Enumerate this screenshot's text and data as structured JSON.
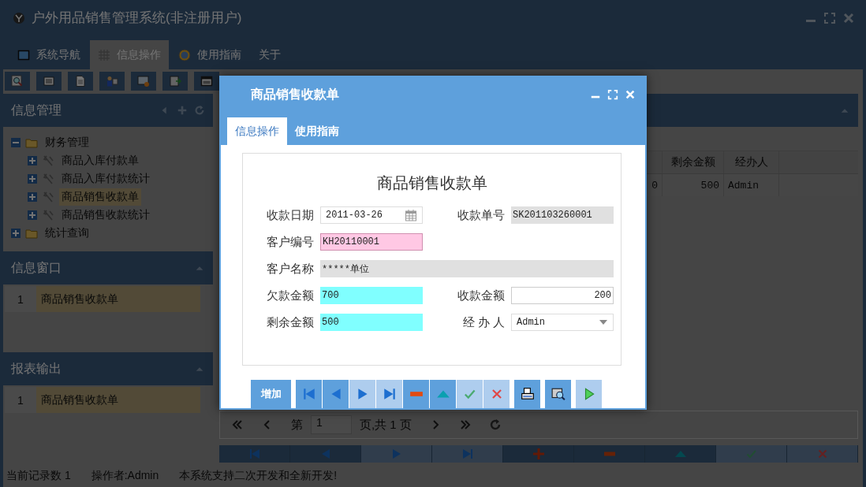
{
  "window": {
    "title": "户外用品销售管理系统(非注册用户)"
  },
  "tabs": [
    {
      "label": "系统导航",
      "selected": false
    },
    {
      "label": "信息操作",
      "selected": true
    },
    {
      "label": "使用指南",
      "selected": false
    },
    {
      "label": "关于",
      "selected": false
    }
  ],
  "toolbar": [
    {
      "kind": "search"
    },
    {
      "kind": "list"
    },
    {
      "kind": "document"
    },
    {
      "kind": "users"
    },
    {
      "kind": "monitor"
    },
    {
      "kind": "export"
    },
    {
      "kind": "window"
    }
  ],
  "sidebar": {
    "tree_title": "信息管理",
    "tree": [
      {
        "label": "财务管理",
        "kind": "folder",
        "expanded": true,
        "selected": false,
        "children": [
          {
            "label": "商品入库付款单",
            "kind": "tool",
            "expanded": false,
            "selected": false
          },
          {
            "label": "商品入库付款统计",
            "kind": "tool",
            "expanded": false,
            "selected": false
          },
          {
            "label": "商品销售收款单",
            "kind": "tool",
            "expanded": false,
            "selected": true
          },
          {
            "label": "商品销售收款统计",
            "kind": "tool",
            "expanded": false,
            "selected": false
          }
        ]
      },
      {
        "label": "统计查询",
        "kind": "folder",
        "expanded": false,
        "selected": false
      }
    ],
    "lists": [
      {
        "title": "信息窗口",
        "rows": [
          {
            "index": "1",
            "label": "商品销售收款单"
          }
        ]
      },
      {
        "title": "报表输出",
        "rows": [
          {
            "index": "1",
            "label": "商品销售收款单"
          }
        ]
      }
    ]
  },
  "grid": {
    "columns": [
      "",
      "剩余金额",
      "经办人"
    ],
    "rows": [
      {
        "cells": [
          "0",
          "500",
          "Admin"
        ]
      }
    ]
  },
  "pager": {
    "page_word": "第",
    "page": "1",
    "total": "页,共 1 页"
  },
  "record_bar": [
    {
      "kind": "first",
      "disabled": false
    },
    {
      "kind": "prev",
      "disabled": false
    },
    {
      "kind": "next",
      "disabled": true
    },
    {
      "kind": "last",
      "disabled": true
    },
    {
      "kind": "add",
      "disabled": false
    },
    {
      "kind": "remove",
      "disabled": false
    },
    {
      "kind": "up",
      "disabled": false
    },
    {
      "kind": "confirm",
      "disabled": true
    },
    {
      "kind": "cancel",
      "disabled": true
    }
  ],
  "status_bar": [
    "当前记录数 1",
    "操作者:Admin",
    "本系统支持二次开发和全新开发!"
  ],
  "dialog": {
    "title": "商品销售收款单",
    "tabs": [
      {
        "label": "信息操作",
        "selected": true
      },
      {
        "label": "使用指南",
        "selected": false
      }
    ],
    "form_title": "商品销售收款单",
    "rows": [
      {
        "fields": [
          {
            "label": "收款日期",
            "value": "2011-03-26",
            "kind": "date"
          },
          {
            "label": "收款单号",
            "value": "SK201103260001",
            "kind": "readonly"
          }
        ]
      },
      {
        "fields": [
          {
            "label": "客户编号",
            "value": "KH20110001",
            "kind": "lookup"
          }
        ]
      },
      {
        "fields": [
          {
            "label": "客户名称",
            "value": "*****单位",
            "kind": "name"
          }
        ]
      },
      {
        "fields": [
          {
            "label": "欠款金额",
            "value": "700",
            "kind": "computed"
          },
          {
            "label": "收款金额",
            "value": "200",
            "kind": "amount"
          }
        ]
      },
      {
        "fields": [
          {
            "label": "剩余金额",
            "value": "500",
            "kind": "computed"
          },
          {
            "label": "经 办 人",
            "value": "Admin",
            "kind": "select"
          }
        ]
      }
    ],
    "button_groups": [
      [
        {
          "kind": "text",
          "label": "增加",
          "disabled": false
        }
      ],
      [
        {
          "kind": "first",
          "disabled": false
        },
        {
          "kind": "prev",
          "disabled": false
        },
        {
          "kind": "next",
          "disabled": true
        },
        {
          "kind": "last",
          "disabled": true
        },
        {
          "kind": "remove",
          "disabled": false
        },
        {
          "kind": "up",
          "disabled": false
        },
        {
          "kind": "confirm",
          "disabled": true
        },
        {
          "kind": "cancel",
          "disabled": true
        }
      ],
      [
        {
          "kind": "print",
          "disabled": false
        }
      ],
      [
        {
          "kind": "preview",
          "disabled": false
        }
      ],
      [
        {
          "kind": "run",
          "disabled": true
        }
      ]
    ]
  }
}
